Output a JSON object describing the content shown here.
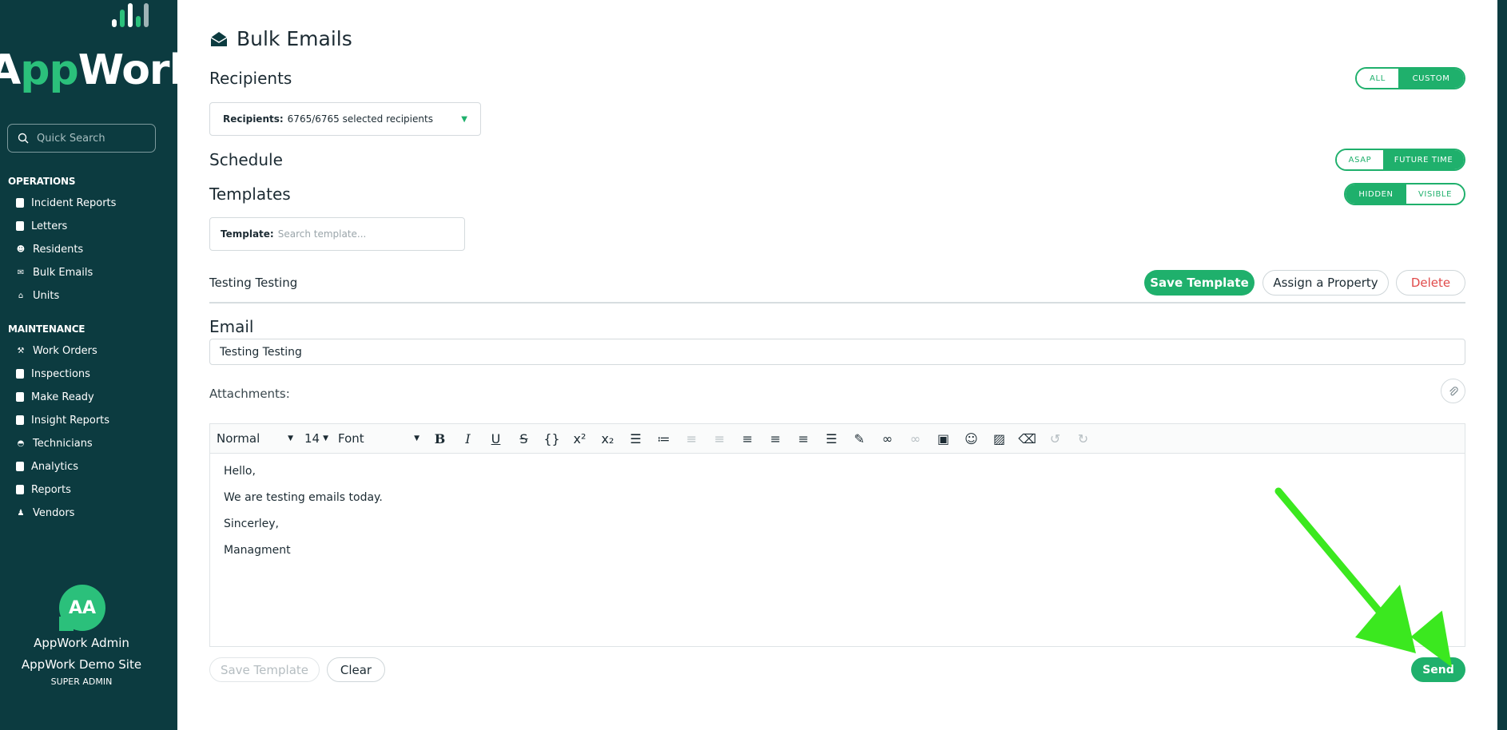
{
  "sidebar": {
    "logo": {
      "text_a": "A",
      "text_pp": "pp",
      "text_work": "Work"
    },
    "search": {
      "placeholder": "Quick Search"
    },
    "operations": {
      "heading": "OPERATIONS",
      "items": [
        {
          "label": "Incident Reports",
          "icon": "document-icon"
        },
        {
          "label": "Letters",
          "icon": "letter-icon"
        },
        {
          "label": "Residents",
          "icon": "people-icon"
        },
        {
          "label": "Bulk Emails",
          "icon": "envelope-icon"
        },
        {
          "label": "Units",
          "icon": "home-icon"
        }
      ]
    },
    "maintenance": {
      "heading": "MAINTENANCE",
      "items": [
        {
          "label": "Work Orders",
          "icon": "hammer-icon"
        },
        {
          "label": "Inspections",
          "icon": "document-icon"
        },
        {
          "label": "Make Ready",
          "icon": "bucket-icon"
        },
        {
          "label": "Insight Reports",
          "icon": "document-icon"
        },
        {
          "label": "Technicians",
          "icon": "hardhat-icon"
        },
        {
          "label": "Analytics",
          "icon": "chart-icon"
        },
        {
          "label": "Reports",
          "icon": "document-icon"
        },
        {
          "label": "Vendors",
          "icon": "person-icon"
        }
      ]
    },
    "user": {
      "initials": "AA",
      "name": "AppWork Admin",
      "site": "AppWork Demo Site",
      "role": "SUPER ADMIN"
    }
  },
  "main": {
    "title": "Bulk Emails",
    "recipients": {
      "heading": "Recipients",
      "toggle": {
        "left": "ALL",
        "right": "CUSTOM",
        "active": "CUSTOM"
      },
      "select_label": "Recipients:",
      "select_value": "6765/6765 selected recipients"
    },
    "schedule": {
      "heading": "Schedule",
      "toggle": {
        "left": "ASAP",
        "right": "FUTURE TIME",
        "active": "FUTURE TIME"
      }
    },
    "templates": {
      "heading": "Templates",
      "toggle": {
        "left": "HIDDEN",
        "right": "VISIBLE",
        "active": "HIDDEN"
      },
      "search_label": "Template:",
      "search_placeholder": "Search template...",
      "current_name": "Testing Testing",
      "save_button": "Save Template",
      "assign_button": "Assign a Property",
      "delete_button": "Delete"
    },
    "email": {
      "heading": "Email",
      "subject": "Testing Testing",
      "attachments_label": "Attachments:",
      "toolbar": {
        "format": "Normal",
        "size": "14",
        "font": "Font"
      },
      "body": [
        "Hello,",
        "We are testing emails today.",
        "Sincerley,",
        "Managment"
      ]
    },
    "footer": {
      "save_template": "Save Template",
      "clear": "Clear",
      "send": "Send"
    }
  },
  "colors": {
    "sidebar": "#0c3b40",
    "accent": "#1fb06c",
    "danger": "#e04a4a",
    "annotation_arrow": "#3be81f"
  }
}
